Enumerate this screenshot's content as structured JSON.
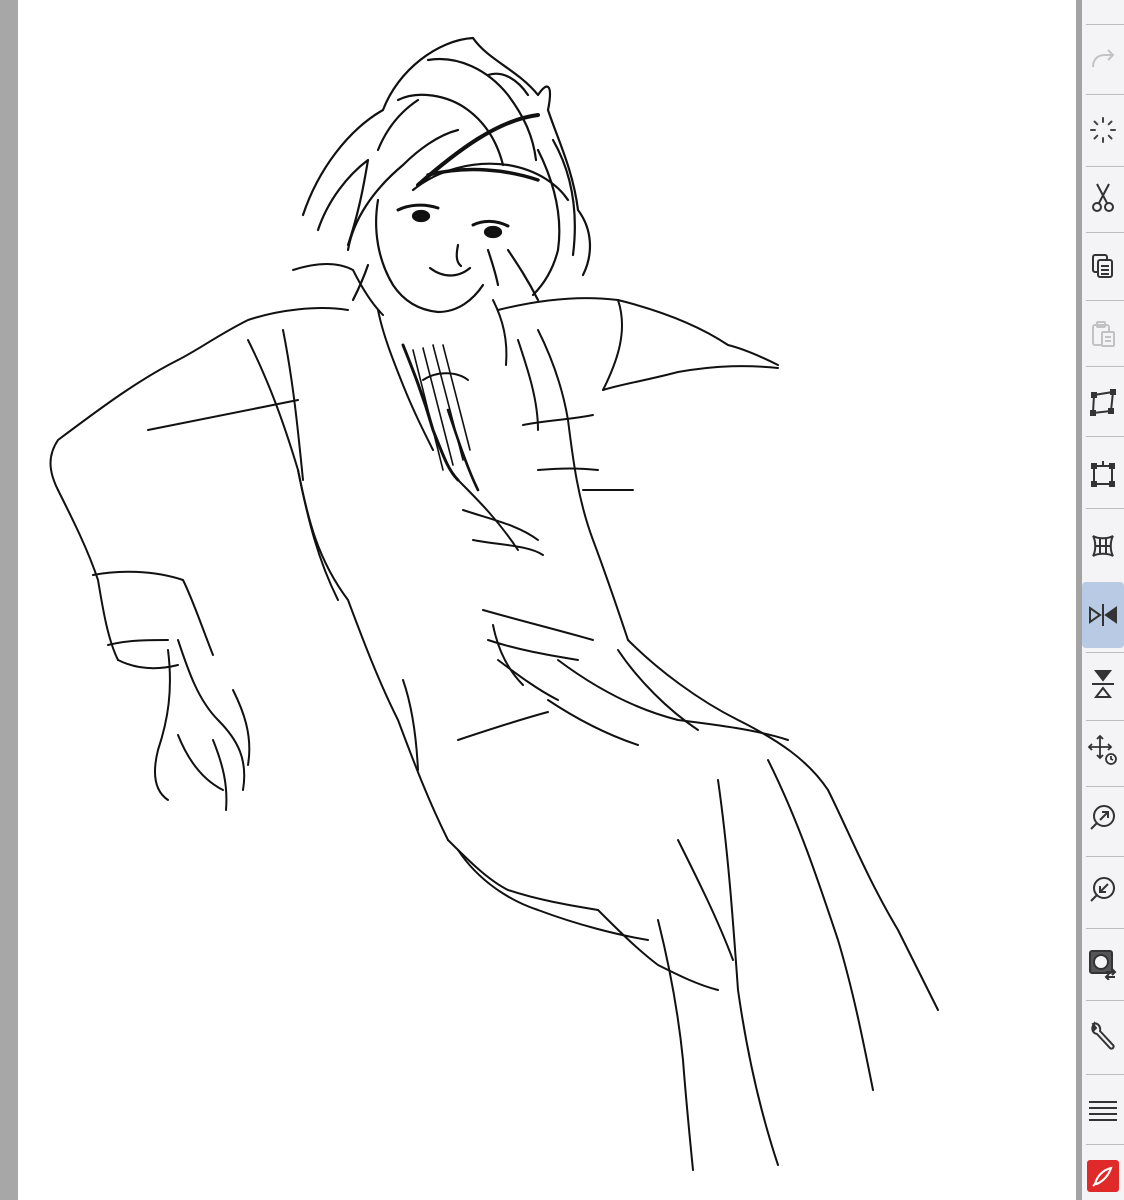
{
  "app": {
    "accent_color": "#b9cbe4",
    "brand_icon_color": "#e02a2a"
  },
  "toolbar": {
    "tools": [
      {
        "name": "redo",
        "icon": "redo-icon",
        "enabled": false
      },
      {
        "name": "loading",
        "icon": "spinner-icon",
        "enabled": true
      },
      {
        "name": "cut",
        "icon": "scissors-icon",
        "enabled": true
      },
      {
        "name": "copy",
        "icon": "copy-icon",
        "enabled": true
      },
      {
        "name": "paste",
        "icon": "paste-icon",
        "enabled": false
      },
      {
        "name": "free-transform",
        "icon": "free-transform-icon",
        "enabled": true
      },
      {
        "name": "scale-rotate",
        "icon": "scale-rotate-icon",
        "enabled": true
      },
      {
        "name": "mesh-transform",
        "icon": "mesh-transform-icon",
        "enabled": true
      },
      {
        "name": "flip-horizontal",
        "icon": "flip-horizontal-icon",
        "enabled": true,
        "active": true
      },
      {
        "name": "flip-vertical",
        "icon": "flip-vertical-icon",
        "enabled": true
      },
      {
        "name": "move-layer",
        "icon": "move-rotate-icon",
        "enabled": true
      },
      {
        "name": "zoom-in",
        "icon": "zoom-in-icon",
        "enabled": true
      },
      {
        "name": "zoom-out",
        "icon": "zoom-out-icon",
        "enabled": true
      },
      {
        "name": "swap-color",
        "icon": "swap-color-icon",
        "enabled": true
      },
      {
        "name": "settings",
        "icon": "wrench-icon",
        "enabled": true
      },
      {
        "name": "menu",
        "icon": "hamburger-menu-icon",
        "enabled": true
      },
      {
        "name": "app",
        "icon": "app-logo-icon",
        "enabled": true
      }
    ]
  }
}
